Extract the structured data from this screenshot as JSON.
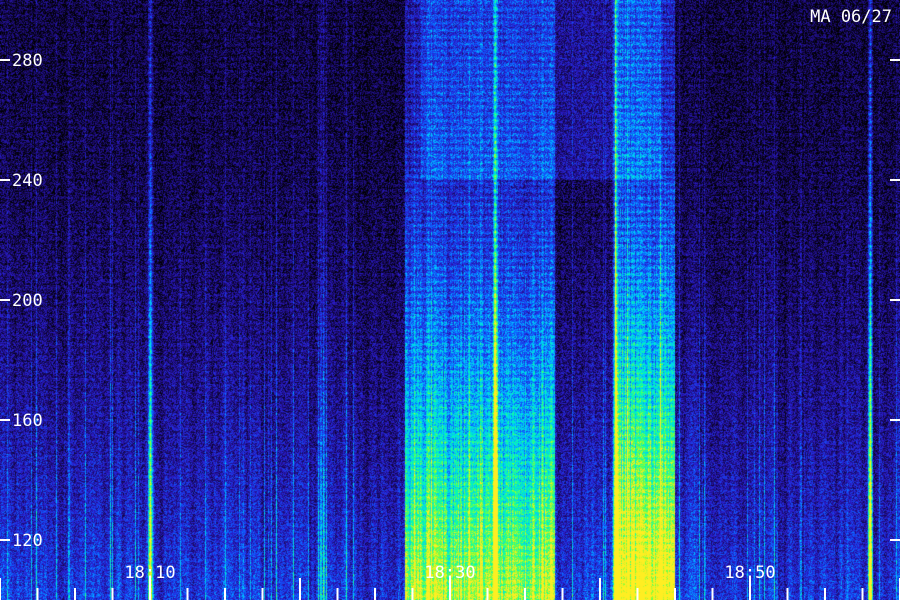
{
  "chart_data": {
    "type": "heatmap",
    "title": "MA 06/27",
    "xlabel": "",
    "ylabel": "",
    "x_ticks": [
      "18:10",
      "18:30",
      "18:50"
    ],
    "y_ticks": [
      120,
      160,
      200,
      240,
      280
    ],
    "x_range": [
      "18:00",
      "19:00"
    ],
    "y_range": [
      100,
      300
    ],
    "grid": false,
    "colormap": [
      "#000000",
      "#1a0a66",
      "#2a1ccc",
      "#0d5cff",
      "#00c8ff",
      "#00ffb0",
      "#7dff3a",
      "#ffee22"
    ],
    "intensity_features": [
      {
        "kind": "broadband_burst",
        "x_start": "18:27",
        "x_end": "18:37",
        "level": 0.6
      },
      {
        "kind": "broadband_burst",
        "x_start": "18:41",
        "x_end": "18:45",
        "level": 0.8
      },
      {
        "kind": "narrow_line",
        "x": "18:33",
        "level": 0.9
      },
      {
        "kind": "narrow_line",
        "x": "18:41",
        "level": 1.0
      },
      {
        "kind": "narrow_line",
        "x": "18:58",
        "level": 0.9
      },
      {
        "kind": "narrow_line",
        "x": "18:10",
        "level": 0.7
      }
    ]
  }
}
